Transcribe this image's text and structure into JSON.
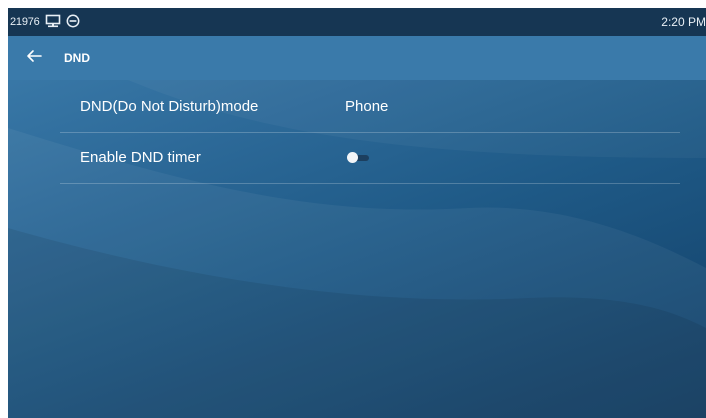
{
  "statusbar": {
    "extension": "21976",
    "time": "2:20 PM",
    "icons": [
      "network-icon",
      "no-disturb-status-icon"
    ]
  },
  "header": {
    "title": "DND",
    "back_icon": "arrow-left-icon"
  },
  "settings": {
    "rows": [
      {
        "label": "DND(Do Not Disturb)mode",
        "value": "Phone"
      },
      {
        "label": "Enable DND timer",
        "toggle_on": false
      }
    ]
  },
  "colors": {
    "statusbar_bg": "#163653",
    "titlebar_bg": "#3a7aaa",
    "background": "#2d6a99",
    "text": "#ffffff"
  }
}
